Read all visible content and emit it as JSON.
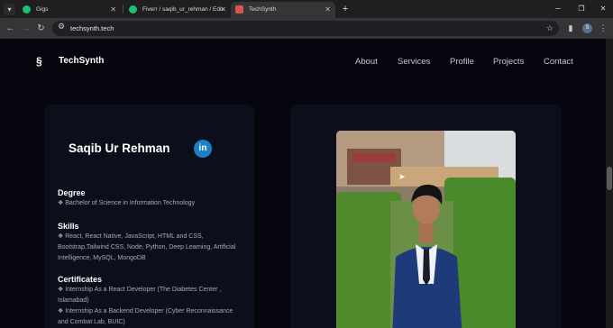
{
  "browser": {
    "tabs": [
      {
        "title": "Gigs",
        "favicon_color": "#1dbf73"
      },
      {
        "title": "Fiverr / saqib_ur_rehman / Edit",
        "favicon_color": "#1dbf73"
      },
      {
        "title": "TechSynth",
        "favicon_color": "#d9534f"
      }
    ],
    "url": "techsynth.tech",
    "profile_initial": "S"
  },
  "site": {
    "brand": "TechSynth",
    "nav": [
      "About",
      "Services",
      "Profile",
      "Projects",
      "Contact"
    ]
  },
  "profile_card": {
    "name": "Saqib Ur Rehman",
    "linkedin": "in",
    "degree_heading": "Degree",
    "degree": "❖ Bachelor of Science in Information Technology",
    "skills_heading": "Skills",
    "skills": "❖ React, React Native, JavaScript, HTML and CSS, Bootstrap,Tailwind CSS, Node, Python, Deep Learning, Artificial Intelligence, MySQL, MongoDB",
    "certificates_heading": "Certificates",
    "certificates": [
      "❖ Internship As a React Developer (The Diabetes Center , Islamabad)",
      "❖ Internship As a Backend Developer (Cyber Reconnaissance and Combat Lab, BUIC)"
    ]
  },
  "colors": {
    "accent": "#1d7fc6",
    "background": "#04050d",
    "card": "#0d0e1b"
  }
}
